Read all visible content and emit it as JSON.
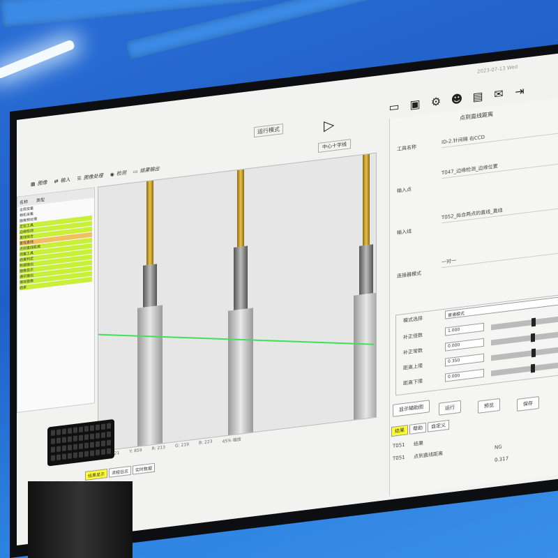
{
  "window": {
    "datetime": "2023-07-13 Wed"
  },
  "top_icons": [
    "monitor-icon",
    "io-icon",
    "gear-icon",
    "user-icon",
    "notepad-icon",
    "chat-icon",
    "exit-icon"
  ],
  "toolbar": {
    "mode_label": "运行模式",
    "items": [
      "图像",
      "输入",
      "图像处理",
      "检测",
      "结果输出"
    ],
    "center_label": "中心十字线"
  },
  "left_panel": {
    "headers": [
      "名称",
      "类型"
    ],
    "rows": [
      {
        "label": "全局变量",
        "style": "normal"
      },
      {
        "label": "相机采集",
        "style": "normal"
      },
      {
        "label": "图像预处理",
        "style": "normal"
      },
      {
        "label": "定位工具",
        "style": "hl"
      },
      {
        "label": "边缘检测",
        "style": "hl"
      },
      {
        "label": "直线拟合",
        "style": "hl"
      },
      {
        "label": "查找直线",
        "style": "or"
      },
      {
        "label": "点到直线距离",
        "style": "hl"
      },
      {
        "label": "测量工具",
        "style": "hl"
      },
      {
        "label": "结果判定",
        "style": "hl"
      },
      {
        "label": "数据输出",
        "style": "hl"
      },
      {
        "label": "图像显示",
        "style": "hl"
      },
      {
        "label": "通讯输出",
        "style": "hl"
      },
      {
        "label": "保存图像",
        "style": "hl"
      },
      {
        "label": "结束",
        "style": "hl"
      }
    ]
  },
  "view": {
    "status": [
      "X: 2021",
      "Y: 859",
      "R: 213",
      "G: 219",
      "B: 223",
      "45% 缩放"
    ],
    "tabs": [
      {
        "label": "结果显示",
        "active": true
      },
      {
        "label": "流程日志",
        "active": false
      },
      {
        "label": "实时数据",
        "active": false
      }
    ]
  },
  "right_panel": {
    "title": "点到直线距离",
    "fields": [
      {
        "label": "工具名称",
        "value": "ID-2.针间隔 右CCD"
      },
      {
        "label": "输入点",
        "value": "T047_边缘检测_边缘位置"
      },
      {
        "label": "输入线",
        "value": "T052_拟合两点的直线_直线"
      },
      {
        "label": "连接器模式",
        "value": "一对一"
      }
    ],
    "mode": {
      "label": "模式选择",
      "value": "普通模式"
    },
    "params": [
      {
        "label": "补正倍数",
        "value": "1.000",
        "level": 0.56
      },
      {
        "label": "补正常数",
        "value": "0.000",
        "level": 0.55
      },
      {
        "label": "距离上限",
        "value": "0.350",
        "level": 0.56
      },
      {
        "label": "距离下限",
        "value": "0.000",
        "level": 0.55
      }
    ],
    "buttons": [
      "显示辅助图",
      "运行",
      "预览",
      "保存"
    ],
    "tabs": [
      {
        "label": "结果",
        "active": true
      },
      {
        "label": "帮助",
        "active": false
      },
      {
        "label": "自定义",
        "active": false
      }
    ],
    "results": [
      {
        "id": "T051",
        "name": "结果",
        "status": "",
        "value": ""
      },
      {
        "id": "T051",
        "name": "点到直线距离",
        "status": "NG",
        "value": "0.317"
      }
    ]
  }
}
